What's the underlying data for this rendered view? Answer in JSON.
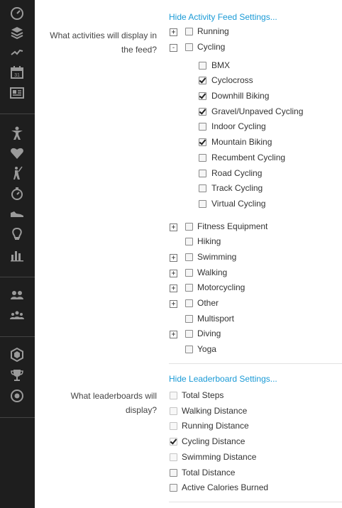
{
  "activity": {
    "hide_link": "Hide Activity Feed Settings...",
    "question": "What activities will display in the feed?",
    "items": [
      {
        "label": "Running",
        "expander": "+",
        "checked": false
      },
      {
        "label": "Cycling",
        "expander": "-",
        "checked": false
      },
      {
        "label": "BMX",
        "checked": false,
        "child": true
      },
      {
        "label": "Cyclocross",
        "checked": true,
        "child": true
      },
      {
        "label": "Downhill Biking",
        "checked": true,
        "child": true
      },
      {
        "label": "Gravel/Unpaved Cycling",
        "checked": true,
        "child": true
      },
      {
        "label": "Indoor Cycling",
        "checked": false,
        "child": true
      },
      {
        "label": "Mountain Biking",
        "checked": true,
        "child": true
      },
      {
        "label": "Recumbent Cycling",
        "checked": false,
        "child": true
      },
      {
        "label": "Road Cycling",
        "checked": false,
        "child": true
      },
      {
        "label": "Track Cycling",
        "checked": false,
        "child": true
      },
      {
        "label": "Virtual Cycling",
        "checked": false,
        "child": true
      },
      {
        "label": "Fitness Equipment",
        "expander": "+",
        "checked": false
      },
      {
        "label": "Hiking",
        "checked": false
      },
      {
        "label": "Swimming",
        "expander": "+",
        "checked": false
      },
      {
        "label": "Walking",
        "expander": "+",
        "checked": false
      },
      {
        "label": "Motorcycling",
        "expander": "+",
        "checked": false
      },
      {
        "label": "Other",
        "expander": "+",
        "checked": false
      },
      {
        "label": "Multisport",
        "checked": false
      },
      {
        "label": "Diving",
        "expander": "+",
        "checked": false
      },
      {
        "label": "Yoga",
        "checked": false
      }
    ]
  },
  "leaderboard": {
    "hide_link": "Hide Leaderboard Settings...",
    "question": "What leaderboards will display?",
    "items": [
      {
        "label": "Total Steps",
        "checked": false,
        "light": true
      },
      {
        "label": "Walking Distance",
        "checked": false,
        "light": true
      },
      {
        "label": "Running Distance",
        "checked": false,
        "light": true
      },
      {
        "label": "Cycling Distance",
        "checked": true,
        "light": true
      },
      {
        "label": "Swimming Distance",
        "checked": false,
        "light": true
      },
      {
        "label": "Total Distance",
        "checked": false
      },
      {
        "label": "Active Calories Burned",
        "checked": false
      }
    ]
  },
  "sidebar": {
    "icons": [
      "dashboard-icon",
      "layers-icon",
      "activity-line-icon",
      "calendar-icon",
      "reports-icon",
      "person-icon",
      "heart-icon",
      "golf-icon",
      "stopwatch-icon",
      "shoe-icon",
      "lightbulb-icon",
      "bar-chart-icon",
      "connections-icon",
      "groups-icon",
      "badge-icon",
      "trophy-icon",
      "target-icon"
    ],
    "calendar_day": "31"
  }
}
